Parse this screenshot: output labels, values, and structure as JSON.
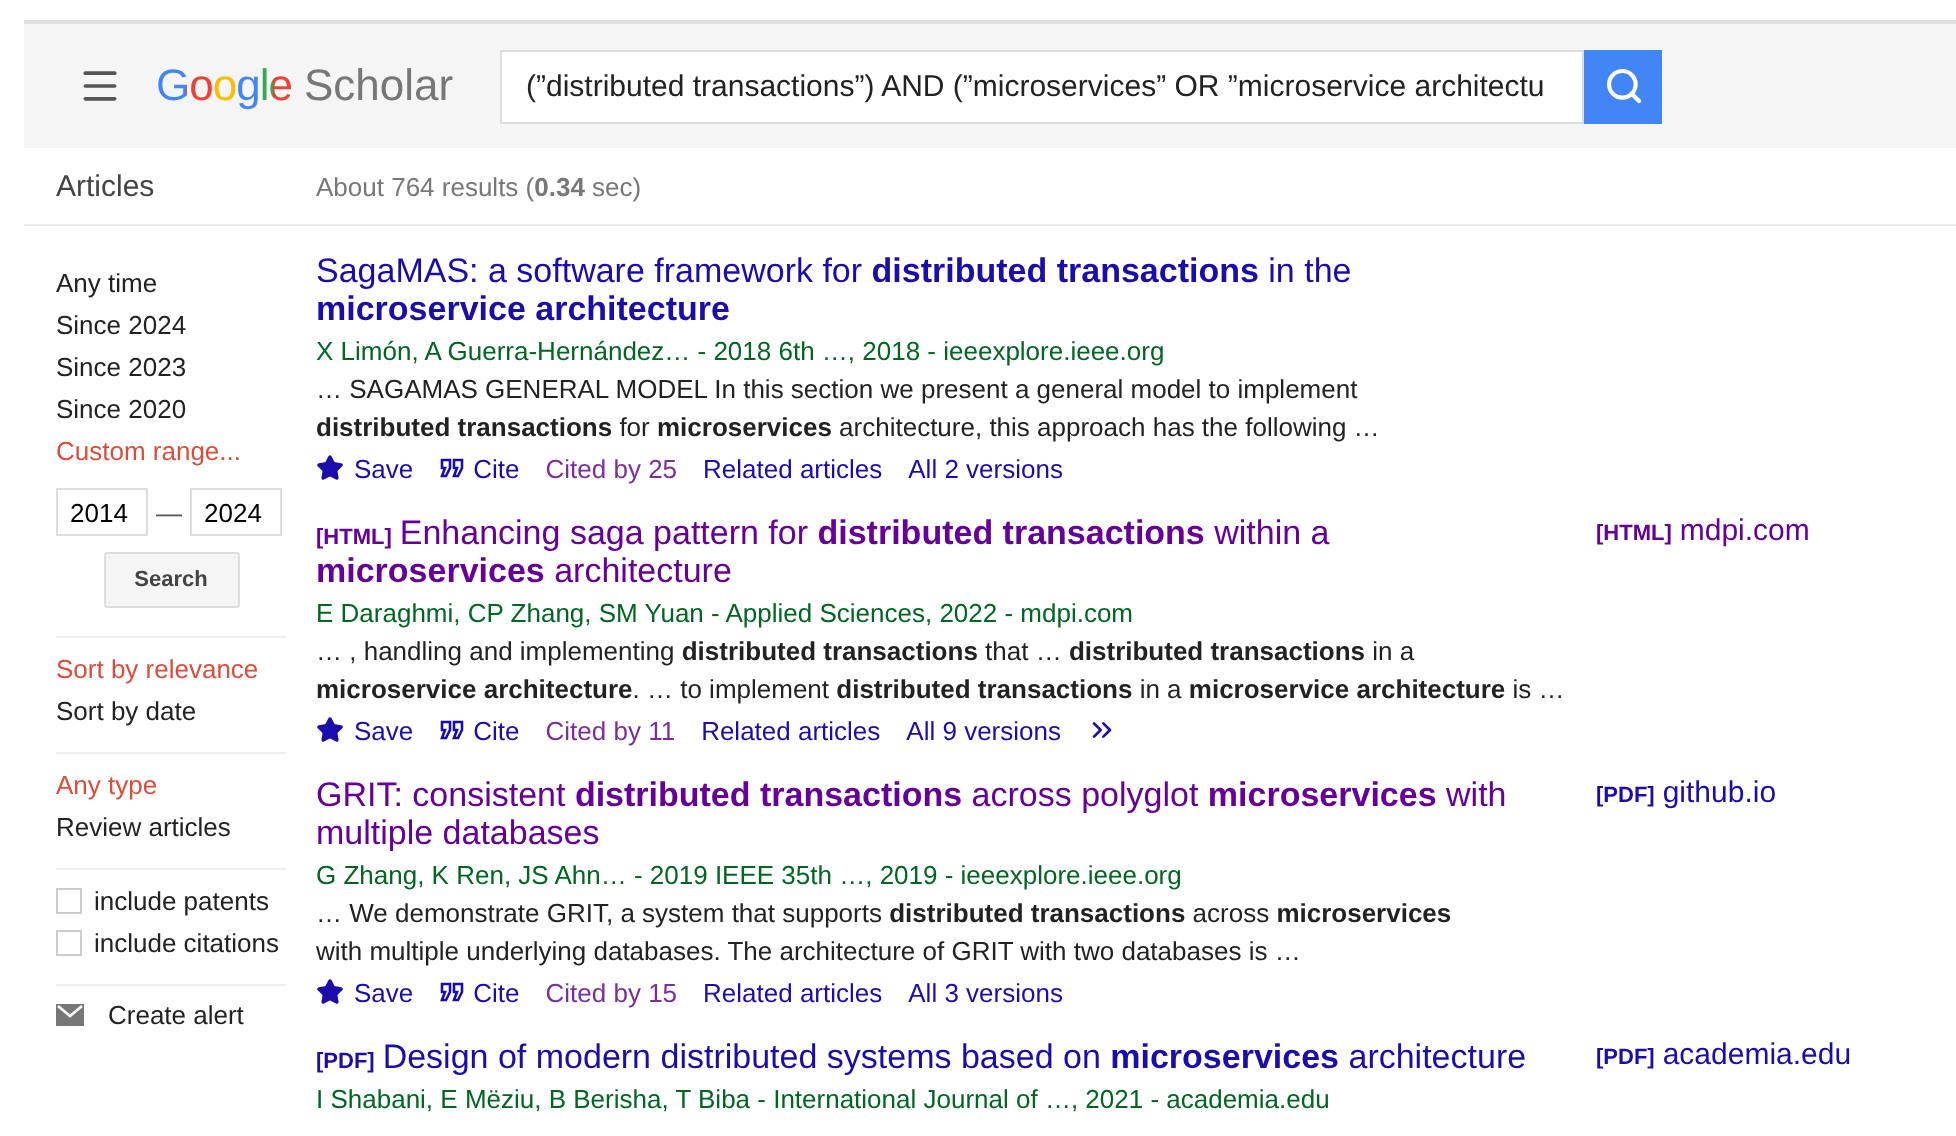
{
  "header": {
    "logo": {
      "brand": "Google",
      "product": "Scholar"
    },
    "search": {
      "value": "(”distributed transactions”) AND (”microservices” OR ”microservice architectu"
    }
  },
  "subheader": {
    "section": "Articles",
    "results_count": "About 764 results (**0.34** sec)"
  },
  "sidebar": {
    "time_filters": [
      {
        "label": "Any time",
        "selected": false
      },
      {
        "label": "Since 2024",
        "selected": false
      },
      {
        "label": "Since 2023",
        "selected": false
      },
      {
        "label": "Since 2020",
        "selected": false
      },
      {
        "label": "Custom range...",
        "selected": true
      }
    ],
    "date_range": {
      "from": "2014",
      "separator": "—",
      "to": "2024",
      "button": "Search"
    },
    "sort": [
      {
        "label": "Sort by relevance",
        "selected": true
      },
      {
        "label": "Sort by date",
        "selected": false
      }
    ],
    "types": [
      {
        "label": "Any type",
        "selected": true
      },
      {
        "label": "Review articles",
        "selected": false
      }
    ],
    "options": [
      {
        "label": "include patents",
        "checked": false
      },
      {
        "label": "include citations",
        "checked": false
      }
    ],
    "create_alert": "Create alert"
  },
  "results": [
    {
      "title": "SagaMAS: a software framework for **distributed transactions** in the **microservice architecture**",
      "visited": false,
      "authors": "X Limón, A Guerra-Hernández… - 2018 6th …, 2018 - ieeexplore.ieee.org",
      "snippet": [
        "… SAGAMAS GENERAL MODEL In this section we present a general model to implement",
        "**distributed transactions** for **microservices** architecture, this approach has the following …"
      ],
      "links": [
        {
          "kind": "save",
          "label": "Save"
        },
        {
          "kind": "cite",
          "label": "Cite"
        },
        {
          "kind": "cited",
          "label": "Cited by 25"
        },
        {
          "kind": "related",
          "label": "Related articles"
        },
        {
          "kind": "versions",
          "label": "All 2 versions"
        }
      ]
    },
    {
      "format": "[HTML]",
      "title": "Enhancing saga pattern for **distributed transactions** within a **microservices** architecture",
      "visited": true,
      "authors": "E Daraghmi, CP Zhang, SM Yuan - Applied Sciences, 2022 - mdpi.com",
      "snippet": [
        "… , handling and implementing **distributed transactions** that … **distributed transactions** in a",
        "**microservice architecture**. … to implement **distributed transactions** in a **microservice architecture** is …"
      ],
      "links": [
        {
          "kind": "save",
          "label": "Save"
        },
        {
          "kind": "cite",
          "label": "Cite"
        },
        {
          "kind": "cited",
          "label": "Cited by 11"
        },
        {
          "kind": "related",
          "label": "Related articles"
        },
        {
          "kind": "versions",
          "label": "All 9 versions"
        },
        {
          "kind": "more"
        }
      ],
      "side": {
        "format": "[HTML]",
        "source": "mdpi.com",
        "visited": true
      }
    },
    {
      "title": "GRIT: consistent **distributed transactions** across polyglot **microservices** with multiple databases",
      "visited": true,
      "authors": "G Zhang, K Ren, JS Ahn… - 2019 IEEE 35th …, 2019 - ieeexplore.ieee.org",
      "snippet": [
        "… We demonstrate GRIT, a system that supports **distributed transactions** across **microservices**",
        "with multiple underlying databases. The architecture of GRIT with two databases is …"
      ],
      "links": [
        {
          "kind": "save",
          "label": "Save"
        },
        {
          "kind": "cite",
          "label": "Cite"
        },
        {
          "kind": "cited",
          "label": "Cited by 15"
        },
        {
          "kind": "related",
          "label": "Related articles"
        },
        {
          "kind": "versions",
          "label": "All 3 versions"
        }
      ],
      "side": {
        "format": "[PDF]",
        "source": "github.io",
        "visited": false
      }
    },
    {
      "format": "[PDF]",
      "title": "Design of modern distributed systems based on **microservices** architecture",
      "visited": false,
      "authors": "I Shabani, E Mëziu, B Berisha, T Biba - International Journal of …, 2021 - academia.edu",
      "side": {
        "format": "[PDF]",
        "source": "academia.edu",
        "visited": false
      }
    }
  ]
}
